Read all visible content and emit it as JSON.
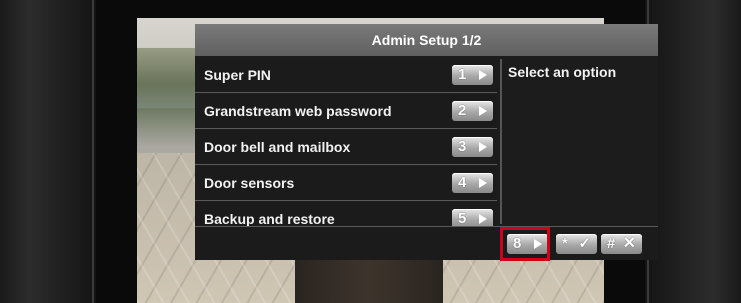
{
  "screen": {
    "title": "Admin Setup 1/2",
    "hint": "Select an option"
  },
  "menu": {
    "items": [
      {
        "label": "Super PIN",
        "key": "1"
      },
      {
        "label": "Grandstream web password",
        "key": "2"
      },
      {
        "label": "Door bell and mailbox",
        "key": "3"
      },
      {
        "label": "Door sensors",
        "key": "4"
      },
      {
        "label": "Backup and restore",
        "key": "5"
      }
    ]
  },
  "footer": {
    "next_page_key": "8",
    "confirm_key": "*",
    "confirm_mark": "✓",
    "cancel_key": "#",
    "cancel_mark": "✕"
  },
  "colors": {
    "highlight": "#d0021b",
    "titlebar": "#6e6e6e",
    "panel": "#1c1c1c"
  },
  "icons": {
    "arrow": "arrow-right-icon",
    "check": "check-icon",
    "close": "close-icon"
  }
}
